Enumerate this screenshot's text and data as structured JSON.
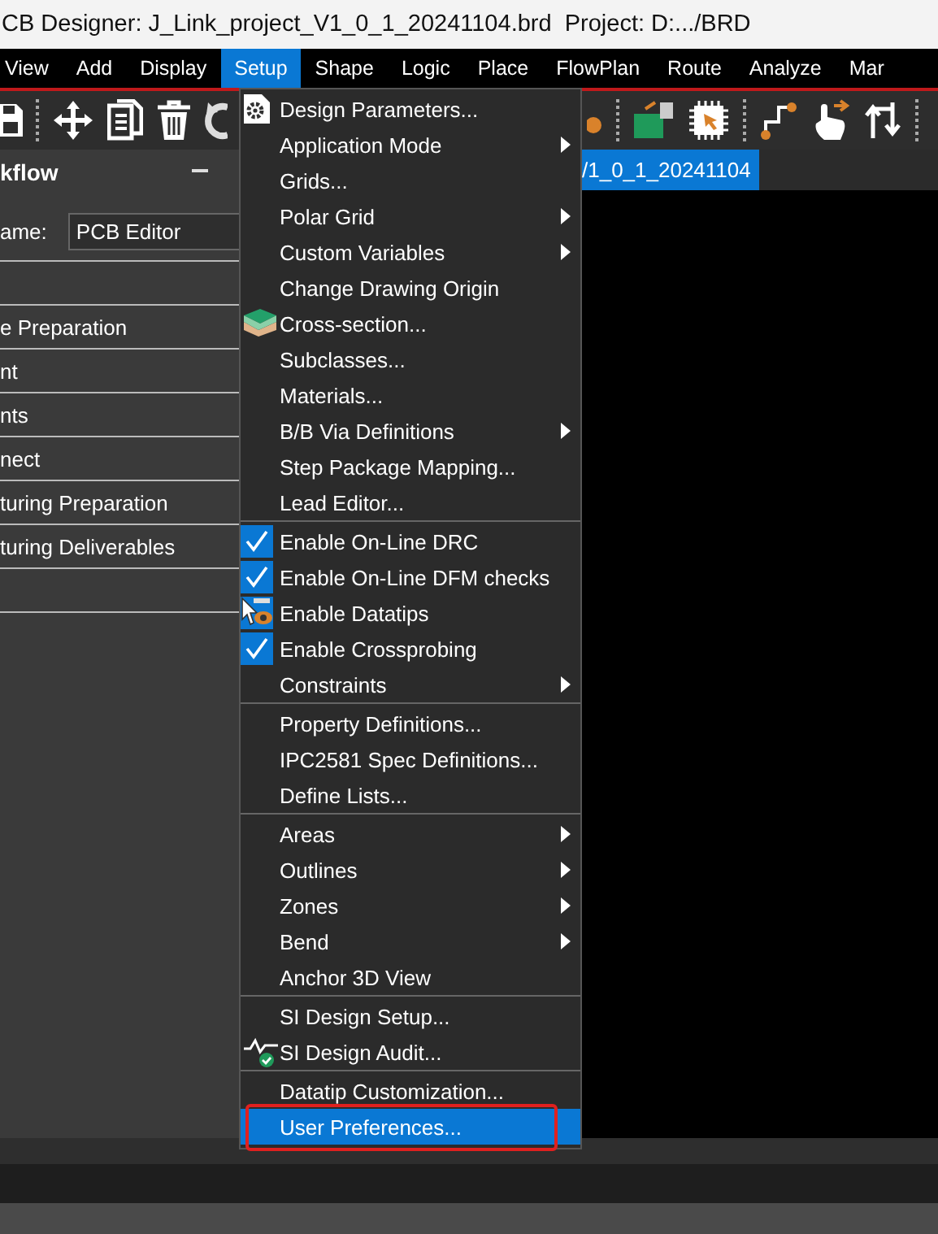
{
  "window": {
    "title": "CB Designer: J_Link_project_V1_0_1_20241104.brd  Project: D:.../BRD"
  },
  "menu_bar": [
    {
      "label": "View",
      "selected": false
    },
    {
      "label": "Add",
      "selected": false
    },
    {
      "label": "Display",
      "selected": false
    },
    {
      "label": "Setup",
      "selected": true
    },
    {
      "label": "Shape",
      "selected": false
    },
    {
      "label": "Logic",
      "selected": false
    },
    {
      "label": "Place",
      "selected": false
    },
    {
      "label": "FlowPlan",
      "selected": false
    },
    {
      "label": "Route",
      "selected": false
    },
    {
      "label": "Analyze",
      "selected": false
    },
    {
      "label": "Mar",
      "selected": false
    }
  ],
  "workflow_panel": {
    "title": "kflow",
    "name_label": "ame:",
    "name_value": "PCB Editor",
    "items": [
      "e Preparation",
      "nt",
      "nts",
      "nect",
      "turing Preparation",
      "turing Deliverables"
    ]
  },
  "document_tab": {
    "label": "/1_0_1_20241104",
    "selected": true
  },
  "setup_menu": {
    "sections": [
      {
        "items": [
          {
            "label": "Design Parameters...",
            "submenu": false,
            "selected": false
          },
          {
            "label": "Application Mode",
            "submenu": true,
            "selected": false
          },
          {
            "label": "Grids...",
            "submenu": false,
            "selected": false
          },
          {
            "label": "Polar Grid",
            "submenu": true,
            "selected": false
          },
          {
            "label": "Custom Variables",
            "submenu": true,
            "selected": false
          },
          {
            "label": "Change Drawing Origin",
            "submenu": false,
            "selected": false
          },
          {
            "label": "Cross-section...",
            "submenu": false,
            "selected": false
          },
          {
            "label": "Subclasses...",
            "submenu": false,
            "selected": false
          },
          {
            "label": "Materials...",
            "submenu": false,
            "selected": false
          },
          {
            "label": "B/B Via Definitions",
            "submenu": true,
            "selected": false
          },
          {
            "label": "Step Package Mapping...",
            "submenu": false,
            "selected": false
          },
          {
            "label": "Lead Editor...",
            "submenu": false,
            "selected": false
          }
        ]
      },
      {
        "items": [
          {
            "label": "Enable On-Line DRC",
            "submenu": false,
            "checked": true,
            "selected": false
          },
          {
            "label": "Enable On-Line DFM checks",
            "submenu": false,
            "checked": true,
            "selected": false
          },
          {
            "label": "Enable Datatips",
            "submenu": false,
            "checked": true,
            "selected": false
          },
          {
            "label": "Enable Crossprobing",
            "submenu": false,
            "checked": true,
            "selected": false
          },
          {
            "label": "Constraints",
            "submenu": true,
            "checked": false,
            "selected": false
          }
        ]
      },
      {
        "items": [
          {
            "label": "Property Definitions...",
            "submenu": false,
            "selected": false
          },
          {
            "label": "IPC2581 Spec Definitions...",
            "submenu": false,
            "selected": false
          },
          {
            "label": "Define Lists...",
            "submenu": false,
            "selected": false
          }
        ]
      },
      {
        "items": [
          {
            "label": "Areas",
            "submenu": true,
            "selected": false
          },
          {
            "label": "Outlines",
            "submenu": true,
            "selected": false
          },
          {
            "label": "Zones",
            "submenu": true,
            "selected": false
          },
          {
            "label": "Bend",
            "submenu": true,
            "selected": false
          },
          {
            "label": "Anchor 3D View",
            "submenu": false,
            "selected": false
          }
        ]
      },
      {
        "items": [
          {
            "label": "SI Design Setup...",
            "submenu": false,
            "selected": false
          },
          {
            "label": "SI Design Audit...",
            "submenu": false,
            "selected": false
          }
        ]
      },
      {
        "items": [
          {
            "label": "Datatip Customization...",
            "submenu": false,
            "selected": false
          },
          {
            "label": "User Preferences...",
            "submenu": false,
            "selected": true
          }
        ]
      }
    ]
  }
}
